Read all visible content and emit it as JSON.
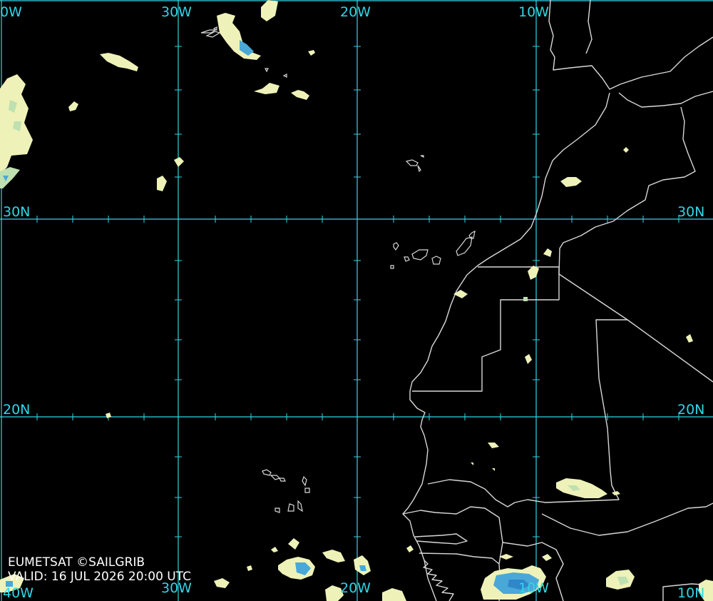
{
  "map": {
    "credit_line": "EUMETSAT ©SAILGRIB",
    "valid_line": "VALID:  16 JUL 2026 20:00 UTC",
    "colors": {
      "background": "#000000",
      "graticule": "#2fd7e6",
      "coastline": "#d8d8d8",
      "cloud_high": "#eef2b8",
      "cloud_mid": "#bfe0b0",
      "cloud_cold": "#49a8d8",
      "credit_text": "#ffffff"
    },
    "graticule": {
      "top_labels": [
        "0W",
        "30W",
        "20W",
        "10W"
      ],
      "bottom_labels": [
        "40W",
        "30W",
        "20W",
        "10W",
        "10N"
      ],
      "left_labels": [
        "30N",
        "20N"
      ],
      "right_labels": [
        "30N",
        "20N"
      ]
    }
  }
}
